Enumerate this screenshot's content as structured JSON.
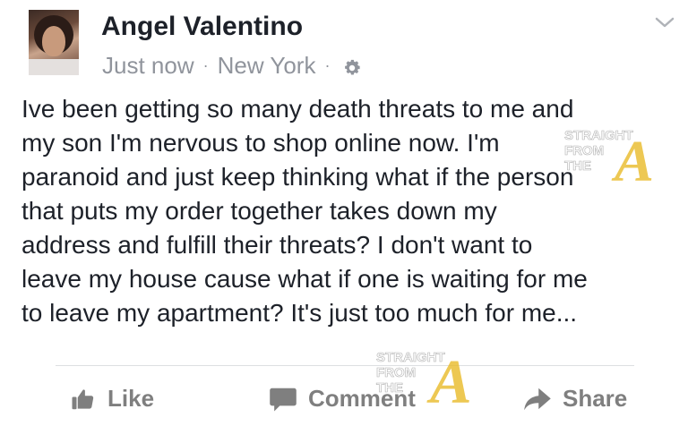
{
  "post": {
    "author_name": "Angel Valentino",
    "timestamp": "Just now",
    "separator": "·",
    "location": "New York",
    "privacy_icon": "gear-icon",
    "menu_icon": "chevron-down-icon",
    "text": "Ive been getting so many death threats to me and\nmy son I'm nervous to shop online now. I'm\nparanoid and just keep thinking what if the person\nthat puts my order together takes down my\naddress and fulfill their threats? I don't want to\nleave my house cause what if one is waiting for me\nto leave my apartment? It's just too much for me..."
  },
  "actions": {
    "like_label": "Like",
    "comment_label": "Comment",
    "share_label": "Share",
    "like_icon": "thumbs-up-icon",
    "comment_icon": "speech-bubble-icon",
    "share_icon": "share-arrow-icon"
  },
  "watermark": {
    "line1": "STRAIGHT",
    "line2": "FROM",
    "line3": "THE",
    "logo_letter": "A",
    "logo_color": "#e8b923"
  }
}
